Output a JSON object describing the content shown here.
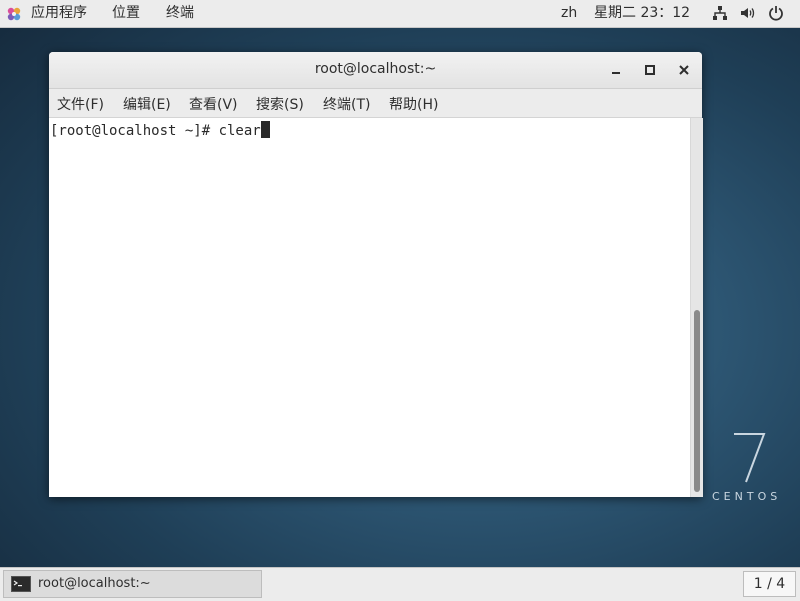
{
  "top_panel": {
    "apps_label": "应用程序",
    "places_label": "位置",
    "terminal_label": "终端",
    "input_method": "zh",
    "datetime": "星期二 23：12",
    "icons": [
      "applications-icon",
      "network-icon",
      "volume-icon",
      "power-icon"
    ]
  },
  "desktop": {
    "logo_number": "7",
    "logo_text": "CENTOS"
  },
  "window": {
    "title": "root@localhost:~",
    "menu": [
      "文件(F)",
      "编辑(E)",
      "查看(V)",
      "搜索(S)",
      "终端(T)",
      "帮助(H)"
    ],
    "prompt": "[root@localhost ~]# ",
    "command": "clear"
  },
  "taskbar": {
    "task_label": "root@localhost:~",
    "workspace": "1 / 4"
  },
  "colors": {
    "panel": "#ececec",
    "desktop": "#2d5673",
    "terminal_bg": "#ffffff",
    "terminal_fg": "#2a2a2a"
  }
}
